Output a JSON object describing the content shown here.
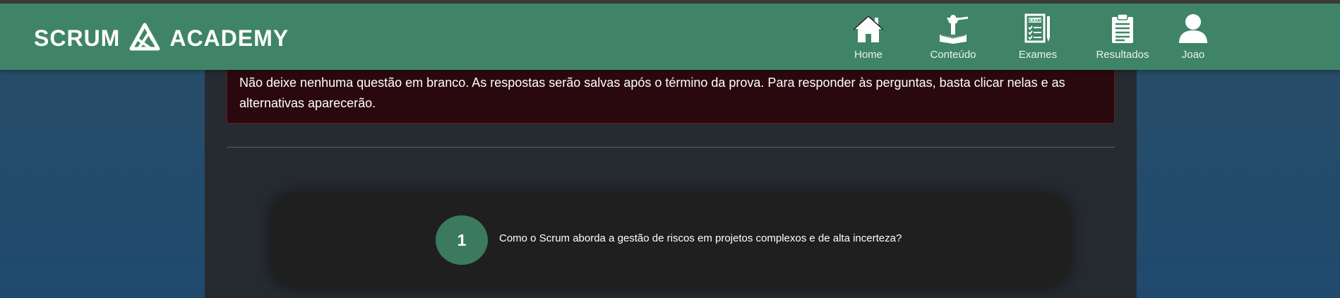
{
  "brand": {
    "left_text": "SCRUM",
    "right_text": "ACADEMY",
    "logo_icon": "scrum-triangle-logo-icon"
  },
  "nav": {
    "items": [
      {
        "label": "Home",
        "icon": "house-icon"
      },
      {
        "label": "Conteúdo",
        "icon": "book-study-icon"
      },
      {
        "label": "Exames",
        "icon": "exam-sheet-icon"
      },
      {
        "label": "Resultados",
        "icon": "clipboard-results-icon"
      },
      {
        "label": "Joao",
        "icon": "user-avatar-icon"
      }
    ]
  },
  "notice": {
    "text": "Não deixe nenhuma questão em branco. As respostas serão salvas após o término da prova. Para responder às perguntas, basta clicar nelas e as alternativas aparecerão."
  },
  "questions": [
    {
      "number": "1",
      "text": "Como o Scrum aborda a gestão de riscos em projetos complexos e de alta incerteza?"
    }
  ],
  "colors": {
    "navbar": "#3f8467",
    "accent_green": "#3b7a5f",
    "notice_bg": "#2a090e",
    "panel_bg": "#262b31",
    "card_bg": "#1f1f1f"
  }
}
